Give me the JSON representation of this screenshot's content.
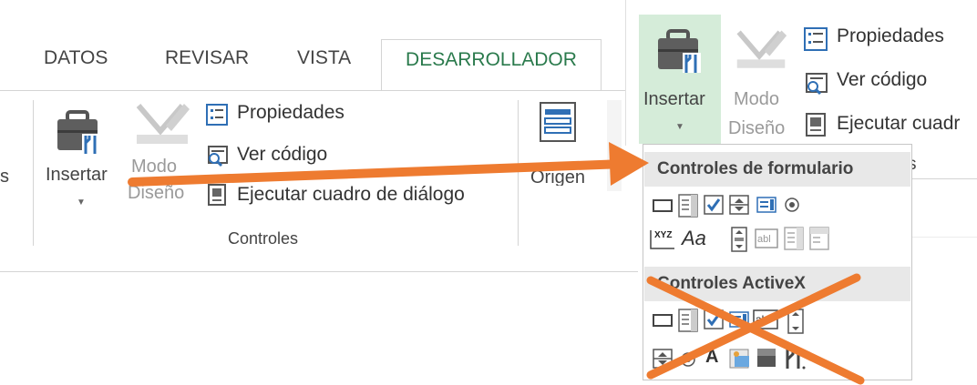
{
  "ribbon": {
    "tabs": [
      "DATOS",
      "REVISAR",
      "VISTA"
    ],
    "active_tab": "DESARROLLADOR",
    "cut_left_label": "s",
    "insert_label": "Insertar",
    "mode_line1": "Modo",
    "mode_line2": "Diseño",
    "properties_label": "Propiedades",
    "view_code_label": "Ver código",
    "run_dialog_label": "Ejecutar cuadro de diálogo",
    "group_label": "Controles",
    "origin_label": "Origen"
  },
  "zoom": {
    "insert_label": "Insertar",
    "mode_line1": "Modo",
    "mode_line2": "Diseño",
    "properties_label": "Propiedades",
    "view_code_label": "Ver código",
    "run_dialog_label": "Ejecutar cuadr",
    "behind_header_text": "s"
  },
  "dropdown": {
    "form_controls_header": "Controles de formulario",
    "activex_header": "Controles ActiveX",
    "activex_label_glyph": "A",
    "xyz_glyph": "XYZ",
    "aa_glyph": "Aa",
    "textbox_glyph": "abl"
  },
  "annotation": {
    "arrow_color": "#ee7b30",
    "cross_color": "#ee7b30"
  }
}
